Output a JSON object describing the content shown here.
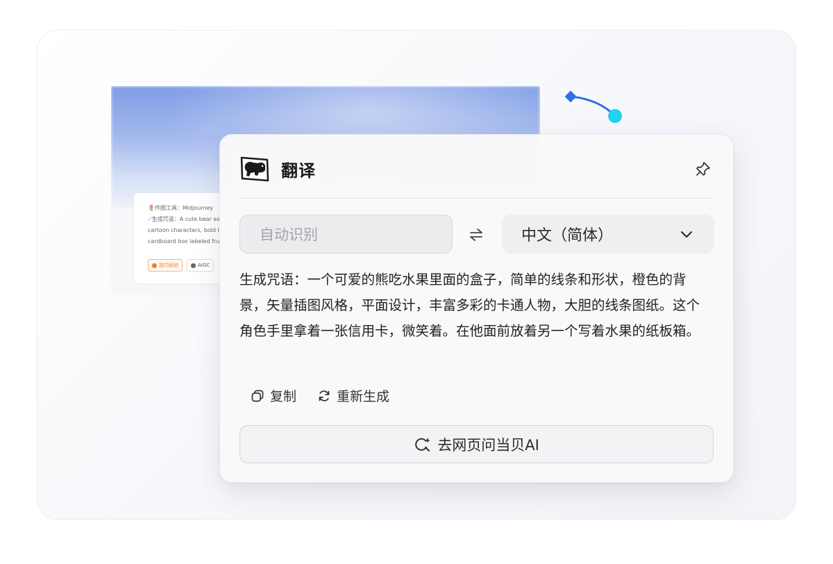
{
  "background_page": {
    "lines": [
      "🌷作图工具：Midjourney",
      "⟋生成咒语：A cute bear ea",
      "cartoon characters, bold li",
      "cardboard box labeled fruit"
    ],
    "tags": [
      "技巧经验",
      "AIGC"
    ]
  },
  "panel": {
    "title": "翻译",
    "source_language": "自动识别",
    "target_language": "中文（简体）",
    "result_text": "生成咒语：一个可爱的熊吃水果里面的盒子，简单的线条和形状，橙色的背景，矢量插图风格，平面设计，丰富多彩的卡通人物，大胆的线条图纸。这个角色手里拿着一张信用卡，微笑着。在他面前放着另一个写着水果的纸板箱。",
    "actions": {
      "copy": "复制",
      "regenerate": "重新生成"
    },
    "web_button": "去网页问当贝AI"
  },
  "icons": {
    "logo": "dog-logo-icon",
    "pin": "pin-icon",
    "swap": "swap-arrows-icon",
    "dropdown": "chevron-down-icon",
    "copy": "copy-icon",
    "regenerate": "refresh-icon",
    "ai_search": "sparkle-search-icon"
  },
  "colors": {
    "accent_blue": "#2f6fe8",
    "accent_cyan": "#22d3ee",
    "tag_orange": "#f07a2b"
  }
}
